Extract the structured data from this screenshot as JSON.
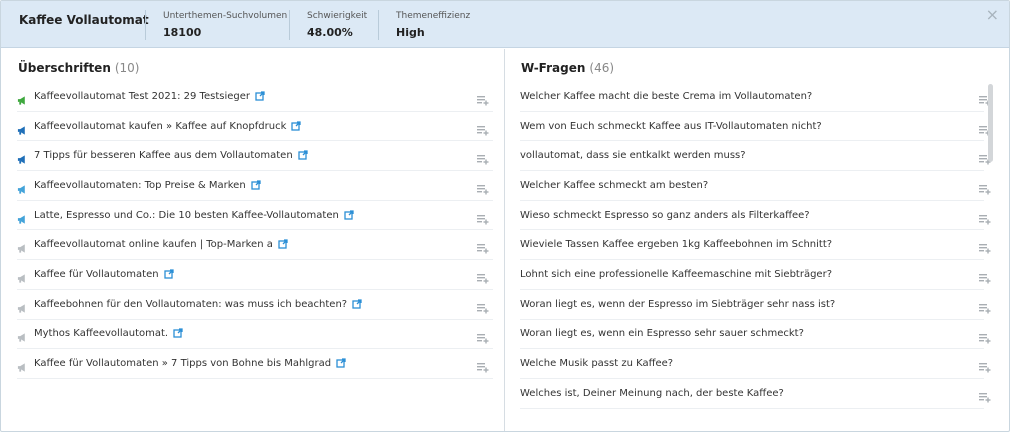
{
  "header": {
    "title": "Kaffee Vollautomat",
    "metrics": [
      {
        "label": "Unterthemen-Suchvolumen",
        "value": "18100"
      },
      {
        "label": "Schwierigkeit",
        "value": "48.00%"
      },
      {
        "label": "Themeneffizienz",
        "value": "High"
      }
    ],
    "close_label": "×"
  },
  "left": {
    "title": "Überschriften",
    "count": "(10)",
    "items": [
      {
        "text": "Kaffeevollautomat Test 2021: 29 Testsieger",
        "level": "green"
      },
      {
        "text": "Kaffeevollautomat kaufen » Kaffee auf Knopfdruck",
        "level": "blue-dark"
      },
      {
        "text": "7 Tipps für besseren Kaffee aus dem Vollautomaten",
        "level": "blue-dark"
      },
      {
        "text": "Kaffeevollautomaten: Top Preise & Marken",
        "level": "blue-light"
      },
      {
        "text": "Latte, Espresso und Co.: Die 10 besten Kaffee-Vollautomaten",
        "level": "blue-light"
      },
      {
        "text": "Kaffeevollautomat online kaufen | Top-Marken a",
        "level": "gray"
      },
      {
        "text": "Kaffee für Vollautomaten",
        "level": "gray"
      },
      {
        "text": "Kaffeebohnen für den Vollautomaten: was muss ich beachten?",
        "level": "gray"
      },
      {
        "text": "Mythos Kaffeevollautomat.",
        "level": "gray"
      },
      {
        "text": "Kaffee für Vollautomaten » 7 Tipps von Bohne bis Mahlgrad",
        "level": "gray"
      }
    ]
  },
  "right": {
    "title": "W-Fragen",
    "count": "(46)",
    "items": [
      "Welcher Kaffee macht die beste Crema im Vollautomaten?",
      "Wem von Euch schmeckt Kaffee aus IT-Vollautomaten nicht?",
      "vollautomat, dass sie entkalkt werden muss?",
      "Welcher Kaffee schmeckt am besten?",
      "Wieso schmeckt Espresso so ganz anders als Filterkaffee?",
      "Wieviele Tassen Kaffee ergeben 1kg Kaffeebohnen im Schnitt?",
      "Lohnt sich eine professionelle Kaffeemaschine mit Siebträger?",
      "Woran liegt es, wenn der Espresso im Siebträger sehr nass ist?",
      "Woran liegt es, wenn ein Espresso sehr sauer schmeckt?",
      "Welche Musik passt zu Kaffee?",
      "Welches ist, Deiner Meinung nach, der beste Kaffee?"
    ]
  },
  "colors": {
    "header_bg": "#dce9f5",
    "link_icon": "#2b8fd6",
    "flag_green": "#3ea83e",
    "flag_blue_dark": "#1f6fb8",
    "flag_blue_light": "#43a3d9",
    "flag_gray": "#b9bec2",
    "add_icon": "#a9aeb3"
  },
  "icons": {
    "close": "close-icon",
    "external_link": "external-link-icon",
    "add_to_list": "add-to-list-icon",
    "megaphone": "megaphone-icon"
  }
}
